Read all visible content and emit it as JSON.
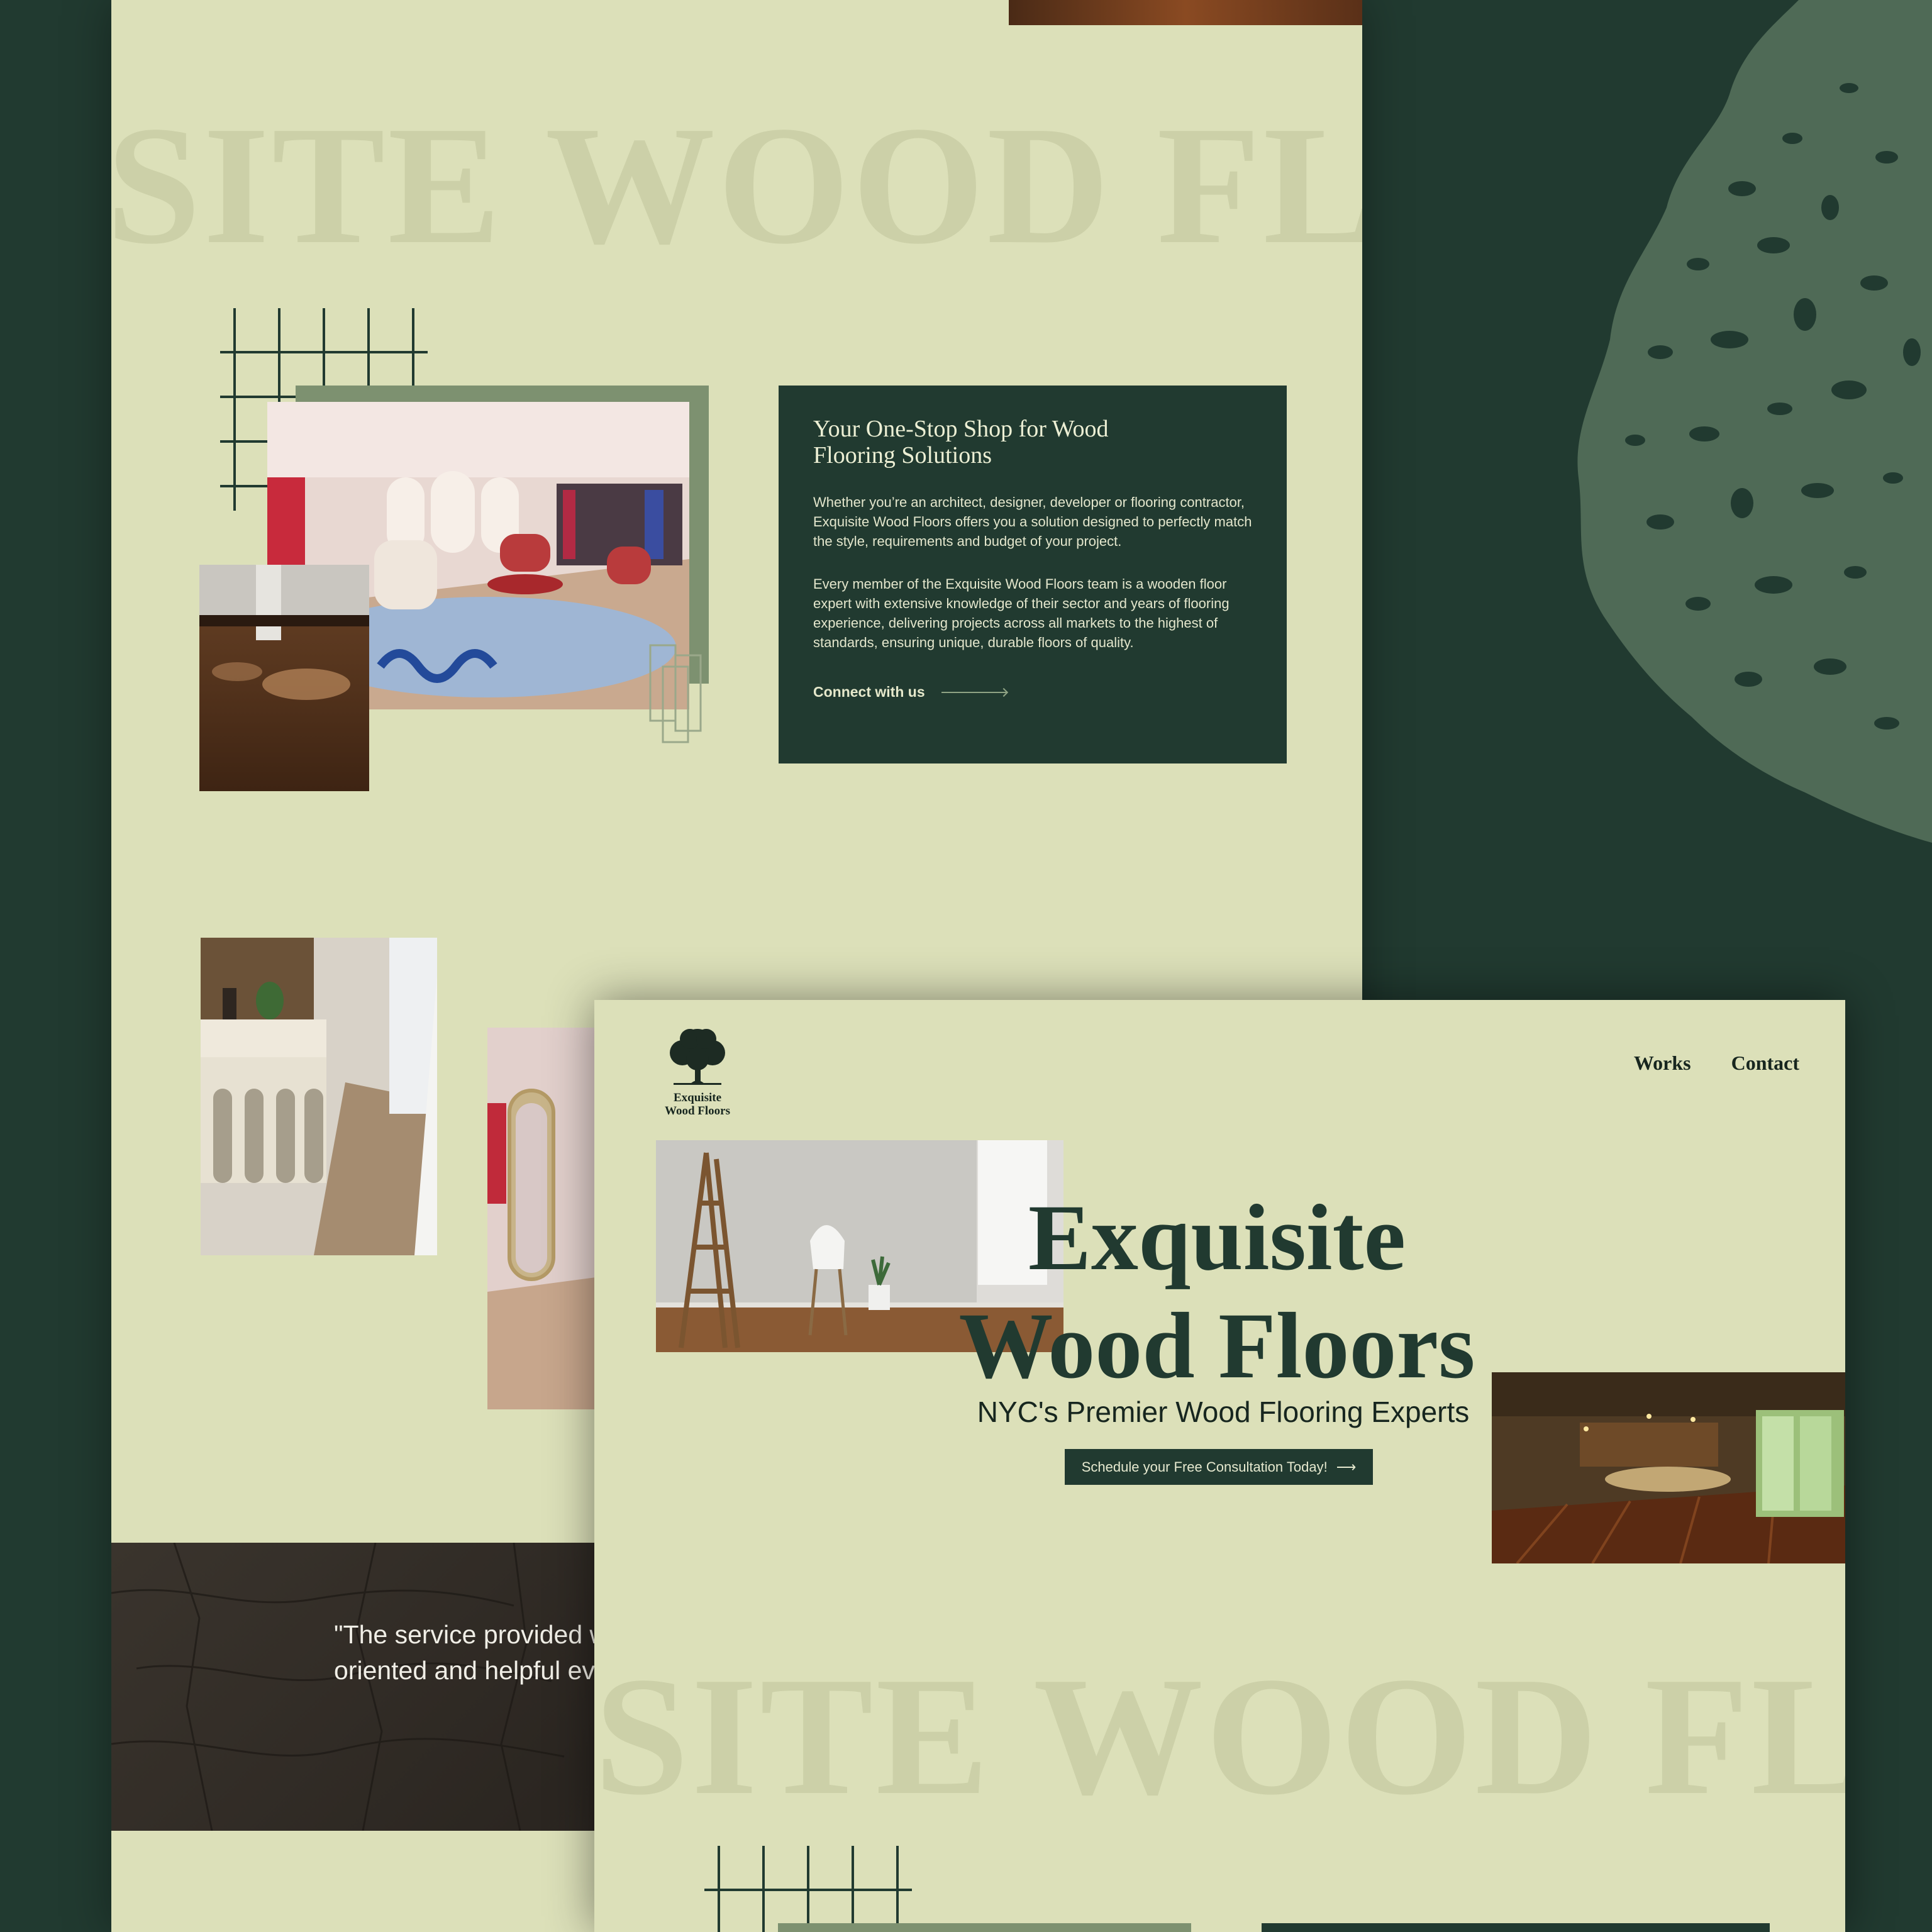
{
  "background": {
    "colors": {
      "dark_green": "#213a30",
      "cream": "#dce0b9",
      "watermark": "#ccd0a8",
      "tree_texture": "#4f6a56"
    }
  },
  "back_page": {
    "watermark_text": "SITE WOOD FL",
    "info_card": {
      "title": "Your One-Stop Shop for Wood Flooring Solutions",
      "paragraph_1": "Whether you’re an architect, designer, developer or flooring contractor, Exquisite Wood Floors offers you a solution designed to perfectly match the style, requirements and budget of your project.",
      "paragraph_2": "Every member of the Exquisite Wood Floors team is a wooden floor expert with extensive knowledge of their sector and years of flooring experience, delivering projects across all markets to the highest of standards, ensuring unique, durable floors of quality.",
      "link_label": "Connect with us"
    },
    "testimonial": "\"The service provided was exceptional, highly customer-oriented and helpful every step of the way.\""
  },
  "front_page": {
    "logo_text": "Exquisite\nWood Floors",
    "nav": {
      "works": "Works",
      "contact": "Contact"
    },
    "hero": {
      "title_line_1": "Exquisite",
      "title_line_2": "Wood Floors",
      "subtitle": "NYC's Premier Wood Flooring Experts",
      "cta_label": "Schedule your Free Consultation Today!",
      "cta_icon": "arrow-right-icon"
    },
    "watermark_text": "SITE WOOD FL"
  }
}
